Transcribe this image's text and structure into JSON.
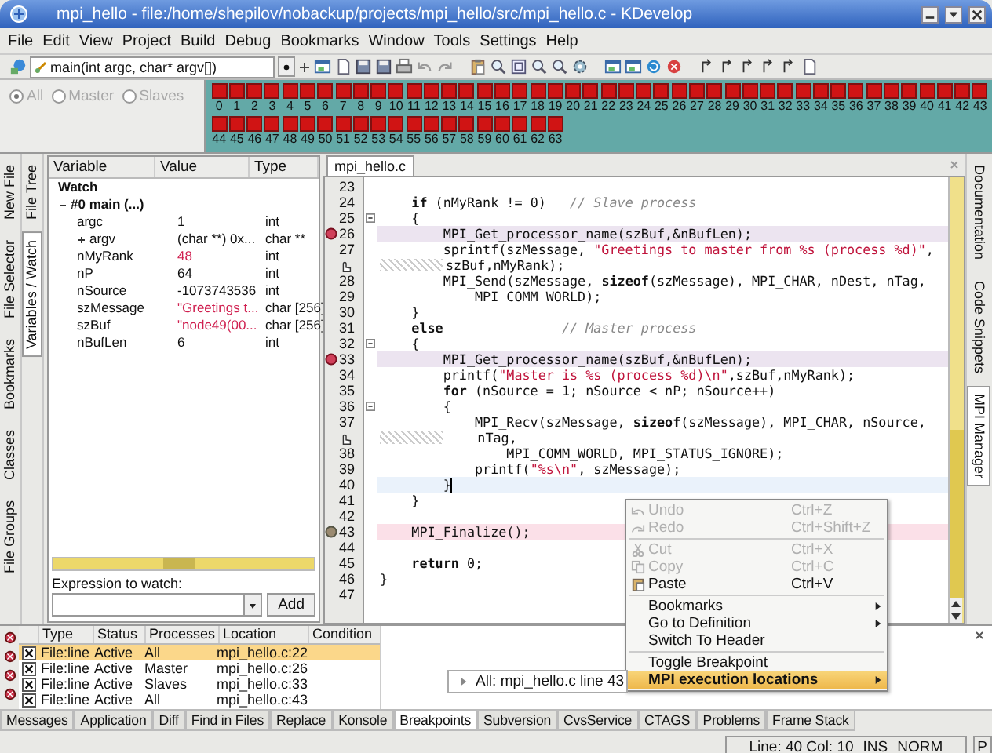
{
  "window": {
    "title": "mpi_hello - file:/home/shepilov/nobackup/projects/mpi_hello/src/mpi_hello.c - KDevelop"
  },
  "menu": [
    "File",
    "Edit",
    "View",
    "Project",
    "Build",
    "Debug",
    "Bookmarks",
    "Window",
    "Tools",
    "Settings",
    "Help"
  ],
  "toolbar": {
    "function_combo": "main(int argc, char* argv[])"
  },
  "mpi_bar": {
    "filters": [
      {
        "label": "All",
        "selected": true,
        "disabled": true
      },
      {
        "label": "Master",
        "selected": false,
        "disabled": true
      },
      {
        "label": "Slaves",
        "selected": false,
        "disabled": true
      }
    ],
    "processes": [
      "0",
      "1",
      "2",
      "3",
      "4",
      "5",
      "6",
      "7",
      "8",
      "9",
      "10",
      "11",
      "12",
      "13",
      "14",
      "15",
      "16",
      "17",
      "18",
      "19",
      "20",
      "21",
      "22",
      "23",
      "24",
      "25",
      "26",
      "27",
      "28",
      "29",
      "30",
      "31",
      "32",
      "33",
      "34",
      "35",
      "36",
      "37",
      "38",
      "39",
      "40",
      "41",
      "42",
      "43",
      "44",
      "45",
      "46",
      "47",
      "48",
      "49",
      "50",
      "51",
      "52",
      "53",
      "54",
      "55",
      "56",
      "57",
      "58",
      "59",
      "60",
      "61",
      "62",
      "63"
    ]
  },
  "left_tabs": [
    {
      "label": "New File",
      "selected": false
    },
    {
      "label": "File Selector",
      "selected": false
    },
    {
      "label": "Bookmarks",
      "selected": false
    },
    {
      "label": "Classes",
      "selected": false
    },
    {
      "label": "File Groups",
      "selected": false
    }
  ],
  "left_tabs_inner": [
    {
      "label": "File Tree",
      "selected": false
    },
    {
      "label": "Variables / Watch",
      "selected": true
    }
  ],
  "variables": {
    "columns": [
      "Variable",
      "Value",
      "Type"
    ],
    "tree": [
      {
        "name": "Watch"
      },
      {
        "name": "#0 main (...)",
        "expanded": true,
        "children": [
          {
            "name": "argc",
            "value": "1",
            "type": "int",
            "changed": false
          },
          {
            "name": "argv",
            "value": "(char **) 0x...",
            "type": "char **",
            "changed": false,
            "expanded": false
          },
          {
            "name": "nMyRank",
            "value": "48",
            "type": "int",
            "changed": true
          },
          {
            "name": "nP",
            "value": "64",
            "type": "int",
            "changed": false
          },
          {
            "name": "nSource",
            "value": "-1073743536",
            "type": "int",
            "changed": false
          },
          {
            "name": "szMessage",
            "value": "\"Greetings t...",
            "type": "char [256]",
            "changed": true
          },
          {
            "name": "szBuf",
            "value": "\"node49(00...",
            "type": "char [256]",
            "changed": true
          },
          {
            "name": "nBufLen",
            "value": "6",
            "type": "int",
            "changed": false
          }
        ]
      }
    ]
  },
  "watch_expression": {
    "label": "Expression to watch:",
    "button": "Add"
  },
  "editor": {
    "tab": "mpi_hello.c",
    "lines": [
      {
        "num": "23"
      },
      {
        "num": "24",
        "parts": [
          {
            "kind": "kw",
            "text": "    if"
          },
          {
            "kind": "plain",
            "text": " (nMyRank != 0)   "
          },
          {
            "kind": "comment",
            "text": "// Slave process"
          }
        ]
      },
      {
        "num": "25",
        "fold": true,
        "parts": [
          {
            "kind": "plain",
            "text": "    {"
          }
        ]
      },
      {
        "num": "26",
        "breakpoint": true,
        "disabled": false,
        "parts": [
          {
            "kind": "plain",
            "text": "        MPI_Get_processor_name(szBuf,&nBufLen);"
          }
        ]
      },
      {
        "num": "27",
        "parts": [
          {
            "kind": "plain",
            "text": "        sprintf(szMessage, "
          },
          {
            "kind": "str",
            "text": "\"Greetings to master from %s (process %d)\""
          },
          {
            "kind": "plain",
            "text": ","
          }
        ]
      },
      {
        "wrap": true,
        "execution_mark": true,
        "parts": [
          {
            "kind": "plain",
            "text": "szBuf,nMyRank);"
          }
        ]
      },
      {
        "num": "28",
        "parts": [
          {
            "kind": "plain",
            "text": "        MPI_Send(szMessage, "
          },
          {
            "kind": "kw",
            "text": "sizeof"
          },
          {
            "kind": "plain",
            "text": "(szMessage), MPI_CHAR, nDest, nTag,"
          }
        ]
      },
      {
        "num": "29",
        "parts": [
          {
            "kind": "plain",
            "text": "            MPI_COMM_WORLD);"
          }
        ]
      },
      {
        "num": "30",
        "parts": [
          {
            "kind": "plain",
            "text": "    }"
          }
        ]
      },
      {
        "num": "31",
        "parts": [
          {
            "kind": "kw",
            "text": "    else"
          },
          {
            "kind": "comment",
            "text": "               // Master process"
          }
        ]
      },
      {
        "num": "32",
        "fold": true,
        "parts": [
          {
            "kind": "plain",
            "text": "    {"
          }
        ]
      },
      {
        "num": "33",
        "breakpoint": true,
        "disabled": false,
        "parts": [
          {
            "kind": "plain",
            "text": "        MPI_Get_processor_name(szBuf,&nBufLen);"
          }
        ]
      },
      {
        "num": "34",
        "parts": [
          {
            "kind": "plain",
            "text": "        printf("
          },
          {
            "kind": "str",
            "text": "\"Master is %s (process %d)\\n\""
          },
          {
            "kind": "plain",
            "text": ",szBuf,nMyRank);"
          }
        ]
      },
      {
        "num": "35",
        "parts": [
          {
            "kind": "kw",
            "text": "        for"
          },
          {
            "kind": "plain",
            "text": " (nSource = 1; nSource < nP; nSource++)"
          }
        ]
      },
      {
        "num": "36",
        "fold": true,
        "parts": [
          {
            "kind": "plain",
            "text": "        {"
          }
        ]
      },
      {
        "num": "37",
        "parts": [
          {
            "kind": "plain",
            "text": "            MPI_Recv(szMessage, "
          },
          {
            "kind": "kw",
            "text": "sizeof"
          },
          {
            "kind": "plain",
            "text": "(szMessage), MPI_CHAR, nSource,"
          }
        ]
      },
      {
        "wrap": true,
        "execution_mark": true,
        "parts": [
          {
            "kind": "plain",
            "text": "    nTag,"
          }
        ]
      },
      {
        "num": "38",
        "parts": [
          {
            "kind": "plain",
            "text": "                MPI_COMM_WORLD, MPI_STATUS_IGNORE);"
          }
        ]
      },
      {
        "num": "39",
        "parts": [
          {
            "kind": "plain",
            "text": "            printf("
          },
          {
            "kind": "str",
            "text": "\"%s\\n\""
          },
          {
            "kind": "plain",
            "text": ", szMessage);"
          }
        ]
      },
      {
        "num": "40",
        "current": true,
        "parts": [
          {
            "kind": "plain",
            "text": "        }"
          }
        ]
      },
      {
        "num": "41",
        "parts": [
          {
            "kind": "plain",
            "text": "    }"
          }
        ]
      },
      {
        "num": "42"
      },
      {
        "num": "43",
        "breakpoint": true,
        "disabled": true,
        "parts": [
          {
            "kind": "plain",
            "text": "    MPI_Finalize();"
          }
        ]
      },
      {
        "num": "44"
      },
      {
        "num": "45",
        "parts": [
          {
            "kind": "kw",
            "text": "    return"
          },
          {
            "kind": "plain",
            "text": " 0;"
          }
        ]
      },
      {
        "num": "46",
        "parts": [
          {
            "kind": "plain",
            "text": "}"
          }
        ]
      },
      {
        "num": "47"
      }
    ]
  },
  "right_tabs": [
    {
      "label": "Documentation",
      "selected": false
    },
    {
      "label": "Code Snippets",
      "selected": false
    },
    {
      "label": "MPI Manager",
      "selected": true
    }
  ],
  "context_menu": {
    "items": [
      {
        "label": "Undo",
        "shortcut": "Ctrl+Z",
        "disabled": true
      },
      {
        "label": "Redo",
        "shortcut": "Ctrl+Shift+Z",
        "disabled": true
      },
      {
        "label": "Cut",
        "shortcut": "Ctrl+X",
        "disabled": true,
        "separator_before": true
      },
      {
        "label": "Copy",
        "shortcut": "Ctrl+C",
        "disabled": true
      },
      {
        "label": "Paste",
        "shortcut": "Ctrl+V",
        "disabled": false
      },
      {
        "label": "Bookmarks",
        "submenu": true,
        "disabled": false,
        "separator_before": true
      },
      {
        "label": "Go to Definition",
        "submenu": true,
        "disabled": false
      },
      {
        "label": "Switch To Header",
        "disabled": false
      },
      {
        "label": "Toggle Breakpoint",
        "disabled": false,
        "separator_before": true
      },
      {
        "label": "MPI execution locations",
        "submenu": true,
        "selected": true,
        "disabled": false
      }
    ]
  },
  "submenu": {
    "items": [
      {
        "label": "All:  mpi_hello.c line 43"
      }
    ]
  },
  "breakpoints": {
    "columns": [
      "Type",
      "Status",
      "Processes",
      "Location",
      "Condition"
    ],
    "rows": [
      {
        "checked": true,
        "selected": true,
        "cells": [
          "File:line",
          "Active",
          "All",
          "mpi_hello.c:22"
        ]
      },
      {
        "checked": true,
        "selected": false,
        "cells": [
          "File:line",
          "Active",
          "Master",
          "mpi_hello.c:26"
        ]
      },
      {
        "checked": true,
        "selected": false,
        "cells": [
          "File:line",
          "Active",
          "Slaves",
          "mpi_hello.c:33"
        ]
      },
      {
        "checked": true,
        "selected": false,
        "cells": [
          "File:line",
          "Active",
          "All",
          "mpi_hello.c:43"
        ]
      }
    ]
  },
  "bottom_tabs": [
    {
      "label": "Messages",
      "selected": false
    },
    {
      "label": "Application",
      "selected": false
    },
    {
      "label": "Diff",
      "selected": false
    },
    {
      "label": "Find in Files",
      "selected": false
    },
    {
      "label": "Replace",
      "selected": false
    },
    {
      "label": "Konsole",
      "selected": false
    },
    {
      "label": "Breakpoints",
      "selected": true
    },
    {
      "label": "Subversion",
      "selected": false
    },
    {
      "label": "CvsService",
      "selected": false
    },
    {
      "label": "CTAGS",
      "selected": false
    },
    {
      "label": "Problems",
      "selected": false
    },
    {
      "label": "Frame Stack",
      "selected": false
    }
  ],
  "status_bar": {
    "position": "Line: 40 Col: 10",
    "insert_mode": "INS",
    "edit_mode": "NORM",
    "extra": "P"
  }
}
